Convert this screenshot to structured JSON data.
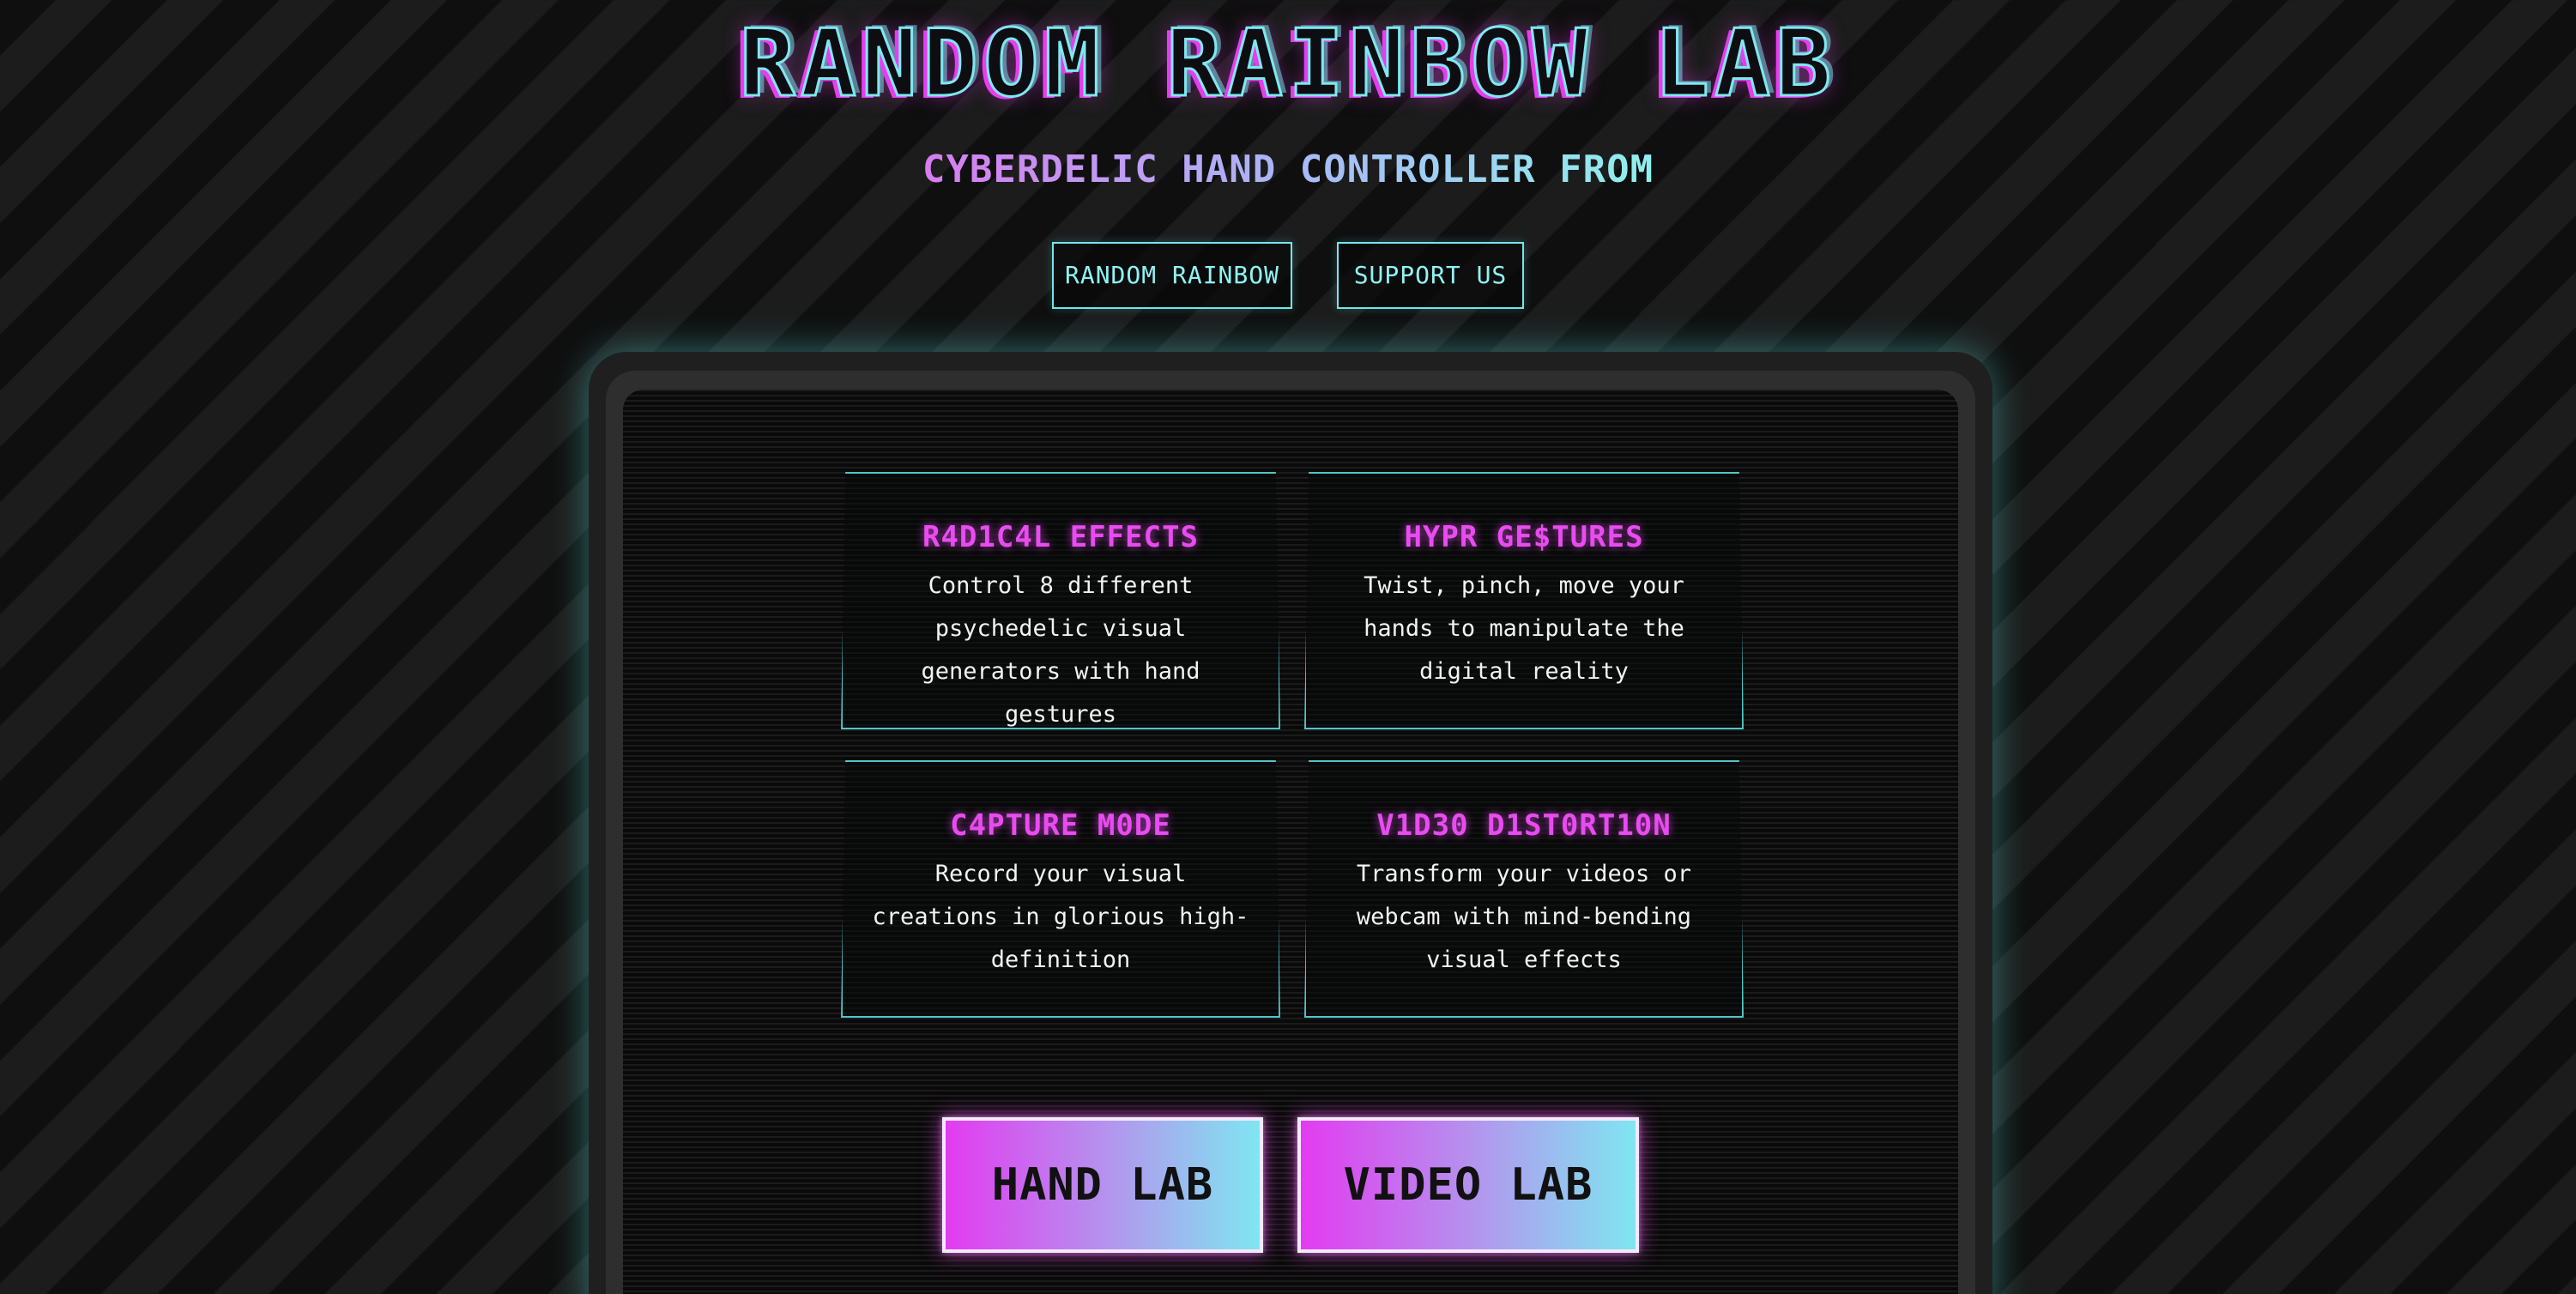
{
  "header": {
    "title": "RANDOM RAINBOW LAB",
    "subtitle": "CYBERDELIC HAND CONTROLLER FROM"
  },
  "nav": {
    "links": [
      {
        "label": "RANDOM RAINBOW"
      },
      {
        "label": "SUPPORT US"
      }
    ]
  },
  "features": [
    {
      "title": "R4D1C4L EFFECTS",
      "description": "Control 8 different psychedelic visual generators with hand gestures"
    },
    {
      "title": "HYPR GE$TURES",
      "description": "Twist, pinch, move your hands to manipulate the digital reality"
    },
    {
      "title": "C4PTURE M0DE",
      "description": "Record your visual creations in glorious high-definition"
    },
    {
      "title": "V1D30 D1ST0RT10N",
      "description": "Transform your videos or webcam with mind-bending visual effects"
    }
  ],
  "actions": {
    "hand_lab": "HAND LAB",
    "video_lab": "VIDEO LAB"
  },
  "colors": {
    "accent_cyan": "#6fe8ea",
    "accent_magenta": "#e84cf0",
    "background": "#141414"
  }
}
